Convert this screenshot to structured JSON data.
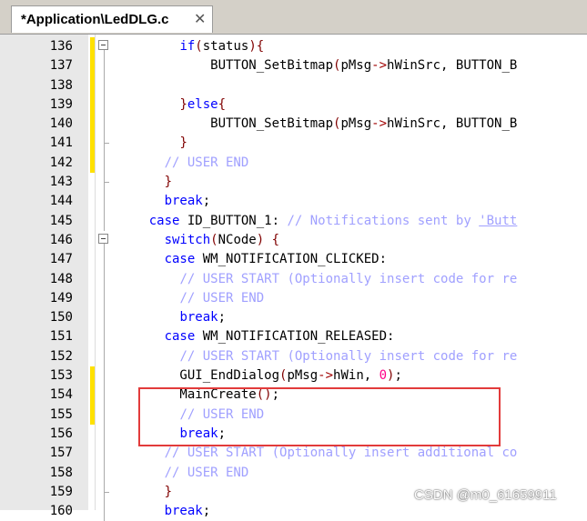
{
  "tab": {
    "label": "*Application\\LedDLG.c",
    "close_icon": "close-icon"
  },
  "lines": [
    {
      "no": "136",
      "mark": true,
      "fold": "start",
      "segs": [
        [
          "",
          "        "
        ],
        [
          "kw",
          "if"
        ],
        [
          "br",
          "("
        ],
        [
          "",
          "status"
        ],
        [
          "br",
          ")"
        ],
        [
          "br",
          "{"
        ]
      ]
    },
    {
      "no": "137",
      "mark": true,
      "fold": "line",
      "segs": [
        [
          "",
          "            BUTTON_SetBitmap"
        ],
        [
          "br",
          "("
        ],
        [
          "",
          "pMsg"
        ],
        [
          "op",
          "->"
        ],
        [
          "",
          "hWinSrc, BUTTON_B"
        ]
      ]
    },
    {
      "no": "138",
      "mark": true,
      "fold": "line",
      "segs": []
    },
    {
      "no": "139",
      "mark": true,
      "fold": "line",
      "segs": [
        [
          "",
          "        "
        ],
        [
          "br",
          "}"
        ],
        [
          "kw",
          "else"
        ],
        [
          "br",
          "{"
        ]
      ]
    },
    {
      "no": "140",
      "mark": true,
      "fold": "line",
      "segs": [
        [
          "",
          "            BUTTON_SetBitmap"
        ],
        [
          "br",
          "("
        ],
        [
          "",
          "pMsg"
        ],
        [
          "op",
          "->"
        ],
        [
          "",
          "hWinSrc, BUTTON_B"
        ]
      ]
    },
    {
      "no": "141",
      "mark": true,
      "fold": "end",
      "segs": [
        [
          "",
          "        "
        ],
        [
          "br",
          "}"
        ]
      ]
    },
    {
      "no": "142",
      "mark": true,
      "fold": "line",
      "segs": [
        [
          "",
          "      "
        ],
        [
          "cmt",
          "// USER END"
        ]
      ]
    },
    {
      "no": "143",
      "mark": false,
      "fold": "end",
      "segs": [
        [
          "",
          "      "
        ],
        [
          "br",
          "}"
        ]
      ]
    },
    {
      "no": "144",
      "mark": false,
      "fold": "line",
      "segs": [
        [
          "",
          "      "
        ],
        [
          "kw",
          "break"
        ],
        [
          "",
          "; "
        ]
      ]
    },
    {
      "no": "145",
      "mark": false,
      "fold": "line",
      "segs": [
        [
          "",
          "    "
        ],
        [
          "kw",
          "case"
        ],
        [
          "",
          " ID_BUTTON_1: "
        ],
        [
          "cmt",
          "// Notifications sent by "
        ],
        [
          "link",
          "'Butt"
        ]
      ]
    },
    {
      "no": "146",
      "mark": false,
      "fold": "start",
      "segs": [
        [
          "",
          "      "
        ],
        [
          "kw",
          "switch"
        ],
        [
          "br",
          "("
        ],
        [
          "",
          "NCode"
        ],
        [
          "br",
          ")"
        ],
        [
          "",
          " "
        ],
        [
          "br",
          "{"
        ]
      ]
    },
    {
      "no": "147",
      "mark": false,
      "fold": "line",
      "segs": [
        [
          "",
          "      "
        ],
        [
          "kw",
          "case"
        ],
        [
          "",
          " WM_NOTIFICATION_CLICKED:"
        ]
      ]
    },
    {
      "no": "148",
      "mark": false,
      "fold": "line",
      "segs": [
        [
          "",
          "        "
        ],
        [
          "cmt",
          "// USER START (Optionally insert code for re"
        ]
      ]
    },
    {
      "no": "149",
      "mark": false,
      "fold": "line",
      "segs": [
        [
          "",
          "        "
        ],
        [
          "cmt",
          "// USER END"
        ]
      ]
    },
    {
      "no": "150",
      "mark": false,
      "fold": "line",
      "segs": [
        [
          "",
          "        "
        ],
        [
          "kw",
          "break"
        ],
        [
          "",
          ";"
        ]
      ]
    },
    {
      "no": "151",
      "mark": false,
      "fold": "line",
      "segs": [
        [
          "",
          "      "
        ],
        [
          "kw",
          "case"
        ],
        [
          "",
          " WM_NOTIFICATION_RELEASED:"
        ]
      ]
    },
    {
      "no": "152",
      "mark": false,
      "fold": "line",
      "segs": [
        [
          "",
          "        "
        ],
        [
          "cmt",
          "// USER START (Optionally insert code for re"
        ]
      ]
    },
    {
      "no": "153",
      "mark": true,
      "fold": "line",
      "segs": [
        [
          "",
          "        GUI_EndDialog"
        ],
        [
          "br",
          "("
        ],
        [
          "",
          "pMsg"
        ],
        [
          "op",
          "->"
        ],
        [
          "",
          "hWin, "
        ],
        [
          "num",
          "0"
        ],
        [
          "br",
          ")"
        ],
        [
          "",
          ";"
        ]
      ]
    },
    {
      "no": "154",
      "mark": true,
      "fold": "line",
      "segs": [
        [
          "",
          "        MainCreate"
        ],
        [
          "br",
          "()"
        ],
        [
          "",
          ";"
        ]
      ]
    },
    {
      "no": "155",
      "mark": true,
      "fold": "line",
      "segs": [
        [
          "",
          "        "
        ],
        [
          "cmt",
          "// USER END"
        ]
      ]
    },
    {
      "no": "156",
      "mark": false,
      "fold": "line",
      "segs": [
        [
          "",
          "        "
        ],
        [
          "kw",
          "break"
        ],
        [
          "",
          ";"
        ]
      ]
    },
    {
      "no": "157",
      "mark": false,
      "fold": "line",
      "segs": [
        [
          "",
          "      "
        ],
        [
          "cmt",
          "// USER START (Optionally insert additional co"
        ]
      ]
    },
    {
      "no": "158",
      "mark": false,
      "fold": "line",
      "segs": [
        [
          "",
          "      "
        ],
        [
          "cmt",
          "// USER END"
        ]
      ]
    },
    {
      "no": "159",
      "mark": false,
      "fold": "end",
      "segs": [
        [
          "",
          "      "
        ],
        [
          "br",
          "}"
        ]
      ]
    },
    {
      "no": "160",
      "mark": false,
      "fold": "line",
      "segs": [
        [
          "",
          "      "
        ],
        [
          "kw",
          "break"
        ],
        [
          "",
          ";"
        ]
      ]
    }
  ],
  "watermark": "CSDN @m0_61659911",
  "colors": {
    "keyword": "#0000ff",
    "comment": "#a0a0ff",
    "bracket": "#800000",
    "number": "#ff0088",
    "change_mark": "#ffe100",
    "highlight_box": "#e23b3b"
  }
}
